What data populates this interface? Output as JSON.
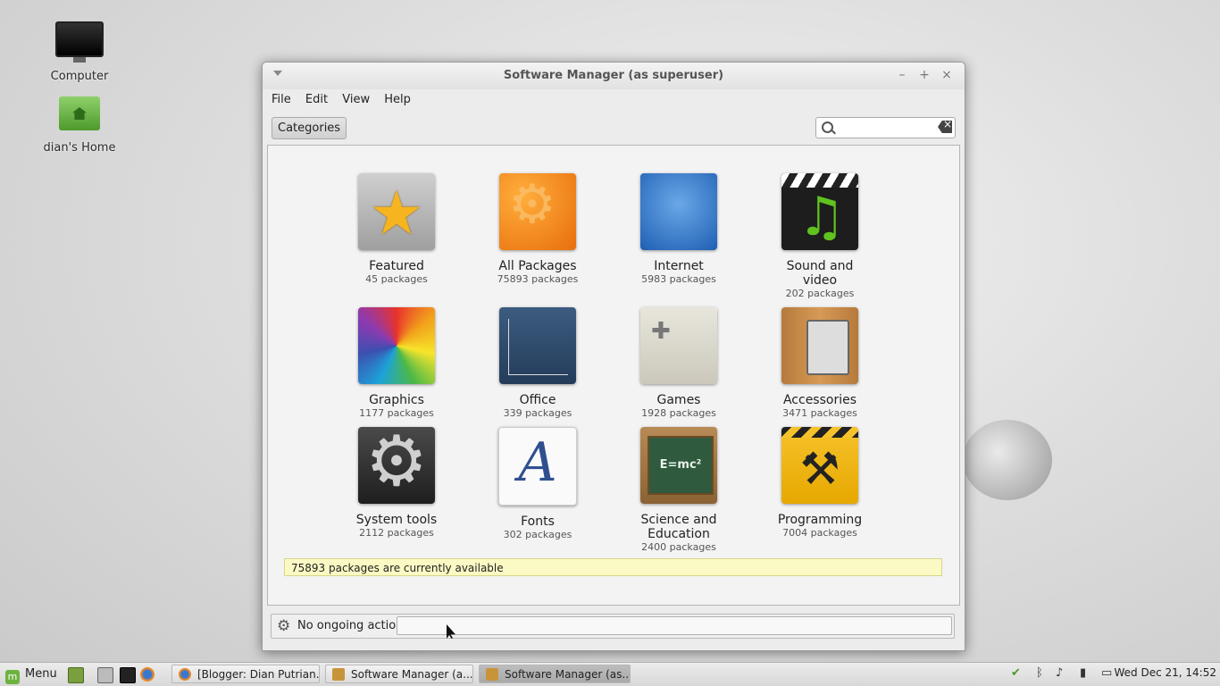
{
  "desktop": {
    "icons": [
      {
        "label": "Computer"
      },
      {
        "label": "dian's Home"
      }
    ]
  },
  "window": {
    "title": "Software Manager (as superuser)",
    "controls": {
      "minimize": "–",
      "maximize": "+",
      "close": "×"
    },
    "menu": [
      "File",
      "Edit",
      "View",
      "Help"
    ],
    "toolbar": {
      "categories_label": "Categories",
      "search_value": ""
    },
    "categories": [
      {
        "name": "Featured",
        "count": "45 packages",
        "icon": "featured-icon"
      },
      {
        "name": "All Packages",
        "count": "75893 packages",
        "icon": "all-packages-icon"
      },
      {
        "name": "Internet",
        "count": "5983 packages",
        "icon": "internet-icon"
      },
      {
        "name": "Sound and video",
        "count": "202 packages",
        "icon": "sound-video-icon"
      },
      {
        "name": "Graphics",
        "count": "1177 packages",
        "icon": "graphics-icon"
      },
      {
        "name": "Office",
        "count": "339 packages",
        "icon": "office-icon"
      },
      {
        "name": "Games",
        "count": "1928 packages",
        "icon": "games-icon"
      },
      {
        "name": "Accessories",
        "count": "3471 packages",
        "icon": "accessories-icon"
      },
      {
        "name": "System tools",
        "count": "2112 packages",
        "icon": "system-tools-icon"
      },
      {
        "name": "Fonts",
        "count": "302 packages",
        "icon": "fonts-icon"
      },
      {
        "name": "Science and Education",
        "count": "2400 packages",
        "icon": "science-icon"
      },
      {
        "name": "Programming",
        "count": "7004 packages",
        "icon": "programming-icon"
      }
    ],
    "info": "75893 packages are currently available",
    "status": "No ongoing actions"
  },
  "taskbar": {
    "menu_label": "Menu",
    "tasks": [
      {
        "label": "[Blogger: Dian Putrian...",
        "active": false
      },
      {
        "label": "Software Manager (a...",
        "active": false
      },
      {
        "label": "Software Manager (as...",
        "active": true
      }
    ],
    "clock": "Wed Dec 21, 14:52"
  },
  "colors": {
    "accent": "#6db33f",
    "info_bg": "#fbfac4"
  }
}
